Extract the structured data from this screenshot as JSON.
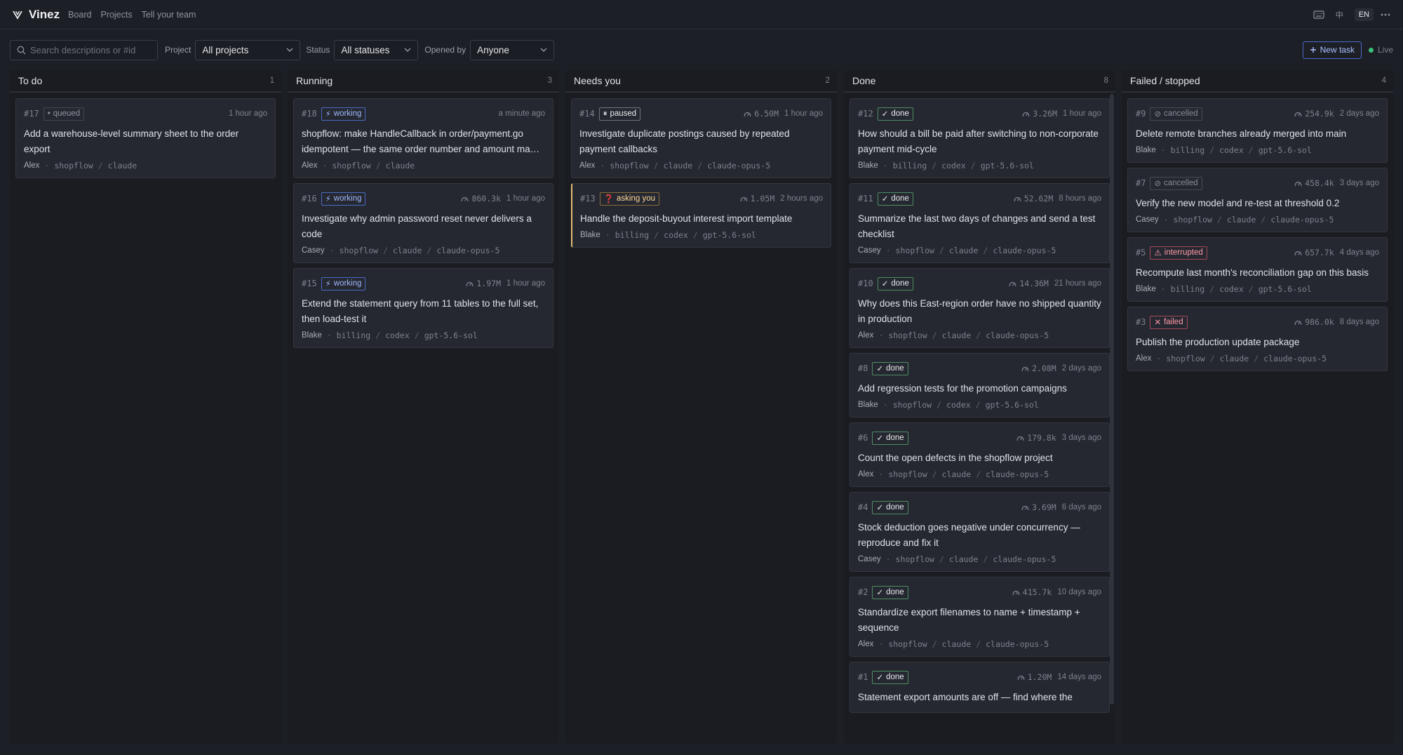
{
  "app": {
    "name": "Vinez",
    "nav": [
      "Board",
      "Projects",
      "Tell your team"
    ],
    "lang_zh": "中",
    "lang_en": "EN"
  },
  "filters": {
    "search_placeholder": "Search descriptions or #id",
    "project_label": "Project",
    "project_value": "All projects",
    "status_label": "Status",
    "status_value": "All statuses",
    "opened_label": "Opened by",
    "opened_value": "Anyone",
    "new_task": "New task",
    "live": "Live"
  },
  "columns": [
    {
      "title": "To do",
      "count": "1",
      "cards": [
        {
          "id": "#17",
          "status": "queued",
          "status_label": "queued",
          "icon": "•",
          "tokens": "",
          "time": "1 hour ago",
          "title": "Add a warehouse-level summary sheet to the order export",
          "who": "Alex",
          "path": [
            "shopflow",
            "claude"
          ]
        }
      ]
    },
    {
      "title": "Running",
      "count": "3",
      "cards": [
        {
          "id": "#18",
          "status": "working",
          "status_label": "working",
          "icon": "⚡",
          "tokens": "",
          "time": "a minute ago",
          "title": "shopflow: make HandleCallback in order/payment.go idempotent — the same order number and amount ma…",
          "who": "Alex",
          "path": [
            "shopflow",
            "claude"
          ]
        },
        {
          "id": "#16",
          "status": "working",
          "status_label": "working",
          "icon": "⚡",
          "tokens": "860.3k",
          "time": "1 hour ago",
          "title": "Investigate why admin password reset never delivers a code",
          "who": "Casey",
          "path": [
            "shopflow",
            "claude",
            "claude-opus-5"
          ]
        },
        {
          "id": "#15",
          "status": "working",
          "status_label": "working",
          "icon": "⚡",
          "tokens": "1.97M",
          "time": "1 hour ago",
          "title": "Extend the statement query from 11 tables to the full set, then load-test it",
          "who": "Blake",
          "path": [
            "billing",
            "codex",
            "gpt-5.6-sol"
          ]
        }
      ]
    },
    {
      "title": "Needs you",
      "count": "2",
      "cards": [
        {
          "id": "#14",
          "status": "paused",
          "status_label": "paused",
          "icon": "⏸",
          "tokens": "6.50M",
          "time": "1 hour ago",
          "title": "Investigate duplicate postings caused by repeated payment callbacks",
          "who": "Alex",
          "path": [
            "shopflow",
            "claude",
            "claude-opus-5"
          ]
        },
        {
          "id": "#13",
          "status": "asking",
          "status_label": "asking you",
          "icon": "❓",
          "tokens": "1.05M",
          "time": "2 hours ago",
          "title": "Handle the deposit-buyout interest import template",
          "who": "Blake",
          "path": [
            "billing",
            "codex",
            "gpt-5.6-sol"
          ],
          "highlight": true
        }
      ]
    },
    {
      "title": "Done",
      "count": "8",
      "cards": [
        {
          "id": "#12",
          "status": "done",
          "status_label": "done",
          "icon": "✓",
          "tokens": "3.26M",
          "time": "1 hour ago",
          "title": "How should a bill be paid after switching to non-corporate payment mid-cycle",
          "who": "Blake",
          "path": [
            "billing",
            "codex",
            "gpt-5.6-sol"
          ]
        },
        {
          "id": "#11",
          "status": "done",
          "status_label": "done",
          "icon": "✓",
          "tokens": "52.62M",
          "time": "8 hours ago",
          "title": "Summarize the last two days of changes and send a test checklist",
          "who": "Casey",
          "path": [
            "shopflow",
            "claude",
            "claude-opus-5"
          ]
        },
        {
          "id": "#10",
          "status": "done",
          "status_label": "done",
          "icon": "✓",
          "tokens": "14.36M",
          "time": "21 hours ago",
          "title": "Why does this East-region order have no shipped quantity in production",
          "who": "Alex",
          "path": [
            "shopflow",
            "claude",
            "claude-opus-5"
          ]
        },
        {
          "id": "#8",
          "status": "done",
          "status_label": "done",
          "icon": "✓",
          "tokens": "2.08M",
          "time": "2 days ago",
          "title": "Add regression tests for the promotion campaigns",
          "who": "Blake",
          "path": [
            "shopflow",
            "codex",
            "gpt-5.6-sol"
          ]
        },
        {
          "id": "#6",
          "status": "done",
          "status_label": "done",
          "icon": "✓",
          "tokens": "179.8k",
          "time": "3 days ago",
          "title": "Count the open defects in the shopflow project",
          "who": "Alex",
          "path": [
            "shopflow",
            "claude",
            "claude-opus-5"
          ]
        },
        {
          "id": "#4",
          "status": "done",
          "status_label": "done",
          "icon": "✓",
          "tokens": "3.69M",
          "time": "6 days ago",
          "title": "Stock deduction goes negative under concurrency — reproduce and fix it",
          "who": "Casey",
          "path": [
            "shopflow",
            "claude",
            "claude-opus-5"
          ]
        },
        {
          "id": "#2",
          "status": "done",
          "status_label": "done",
          "icon": "✓",
          "tokens": "415.7k",
          "time": "10 days ago",
          "title": "Standardize export filenames to name + timestamp + sequence",
          "who": "Alex",
          "path": [
            "shopflow",
            "claude",
            "claude-opus-5"
          ]
        },
        {
          "id": "#1",
          "status": "done",
          "status_label": "done",
          "icon": "✓",
          "tokens": "1.20M",
          "time": "14 days ago",
          "title": "Statement export amounts are off — find where the",
          "who": "",
          "path": []
        }
      ]
    },
    {
      "title": "Failed / stopped",
      "count": "4",
      "cards": [
        {
          "id": "#9",
          "status": "cancelled",
          "status_label": "cancelled",
          "icon": "⊘",
          "tokens": "254.9k",
          "time": "2 days ago",
          "title": "Delete remote branches already merged into main",
          "who": "Blake",
          "path": [
            "billing",
            "codex",
            "gpt-5.6-sol"
          ]
        },
        {
          "id": "#7",
          "status": "cancelled",
          "status_label": "cancelled",
          "icon": "⊘",
          "tokens": "458.4k",
          "time": "3 days ago",
          "title": "Verify the new model and re-test at threshold 0.2",
          "who": "Casey",
          "path": [
            "shopflow",
            "claude",
            "claude-opus-5"
          ]
        },
        {
          "id": "#5",
          "status": "interrupted",
          "status_label": "interrupted",
          "icon": "⚠",
          "tokens": "657.7k",
          "time": "4 days ago",
          "title": "Recompute last month's reconciliation gap on this basis",
          "who": "Blake",
          "path": [
            "billing",
            "codex",
            "gpt-5.6-sol"
          ]
        },
        {
          "id": "#3",
          "status": "failed",
          "status_label": "failed",
          "icon": "✕",
          "tokens": "986.0k",
          "time": "8 days ago",
          "title": "Publish the production update package",
          "who": "Alex",
          "path": [
            "shopflow",
            "claude",
            "claude-opus-5"
          ]
        }
      ]
    }
  ]
}
